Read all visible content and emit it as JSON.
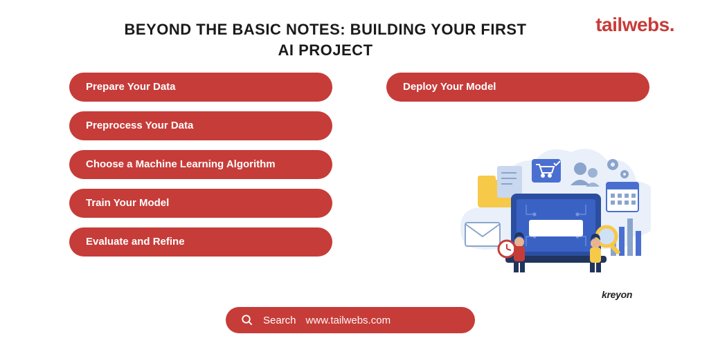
{
  "brand": {
    "name": "tailwebs",
    "dot": "."
  },
  "title_line1": "BEYOND THE BASIC NOTES: BUILDING YOUR FIRST",
  "title_line2": "AI PROJECT",
  "left_pills": [
    "Prepare Your Data",
    "Preprocess Your Data",
    "Choose a Machine Learning Algorithm",
    "Train Your Model",
    "Evaluate and Refine"
  ],
  "right_pills": [
    "Deploy Your Model"
  ],
  "search": {
    "label": "Search",
    "url": "www.tailwebs.com"
  },
  "illustration_credit": "kreyon",
  "colors": {
    "accent": "#c63c39",
    "text": "#1a1a1a"
  }
}
